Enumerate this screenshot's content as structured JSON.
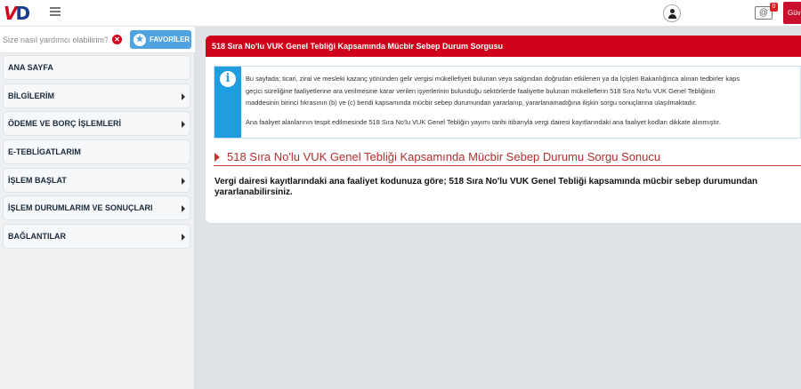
{
  "header": {
    "logo_part1": "V",
    "logo_part2": "D",
    "mail_label": "@",
    "mail_count": "0",
    "right_button": "Güv"
  },
  "sidebar": {
    "search_placeholder": "Size nasıl yardımcı olabilirim?",
    "favorites_label": "FAVORİLER",
    "items": [
      {
        "label": "ANA SAYFA",
        "has_submenu": false
      },
      {
        "label": "BİLGİLERİM",
        "has_submenu": true
      },
      {
        "label": "ÖDEME VE BORÇ İŞLEMLERİ",
        "has_submenu": true
      },
      {
        "label": "E-TEBLİGATLARIM",
        "has_submenu": false
      },
      {
        "label": "İŞLEM BAŞLAT",
        "has_submenu": true
      },
      {
        "label": "İŞLEM DURUMLARIM VE SONUÇLARI",
        "has_submenu": true
      },
      {
        "label": "BAĞLANTILAR",
        "has_submenu": true
      }
    ]
  },
  "main": {
    "panel_title": "518 Sıra No'lu VUK Genel Tebliği Kapsamında Mücbir Sebep Durum Sorgusu",
    "info_lines": [
      "Bu sayfada; ticari, zirai ve mesleki kazanç yönünden gelir vergisi mükellefiyeti bulunan veya salgından doğrudan etkilenen ya da İçişleri Bakanlığınca alınan tedbirler kaps",
      "geçici süreliğine faaliyetlerine ara verilmesine karar verilen işyerlerinin bulunduğu sektörlerde faaliyette bulunan mükelleflerin 518 Sıra No'lu VUK Genel Tebliğinin",
      "maddesinin birinci fıkrasının (b) ve (c) bendi kapsamında mücbir sebep durumundan yararlanıp, yararlanamadığına ilişkin sorgu sonuçlarına ulaşılmaktadır.",
      "Ana faaliyet alanlarının tespit edilmesinde 518 Sıra No'lu VUK Genel Tebliğin yayımı tarihi itibarıyla vergi dairesi kayıtlarındaki ana faaliyet kodları dikkate alınmıştır."
    ],
    "result_title": "518 Sıra No'lu VUK Genel Tebliği Kapsamında Mücbir Sebep Durumu Sorgu Sonucu",
    "result_text": "Vergi dairesi kayıtlarındaki ana faaliyet kodunuza göre; 518 Sıra No'lu VUK Genel Tebliği kapsamında mücbir sebep durumundan yararlanabilirsiniz."
  },
  "colors": {
    "brand_red": "#d0021b",
    "info_blue": "#1f9de0",
    "favorites_blue": "#4fa3e0"
  }
}
